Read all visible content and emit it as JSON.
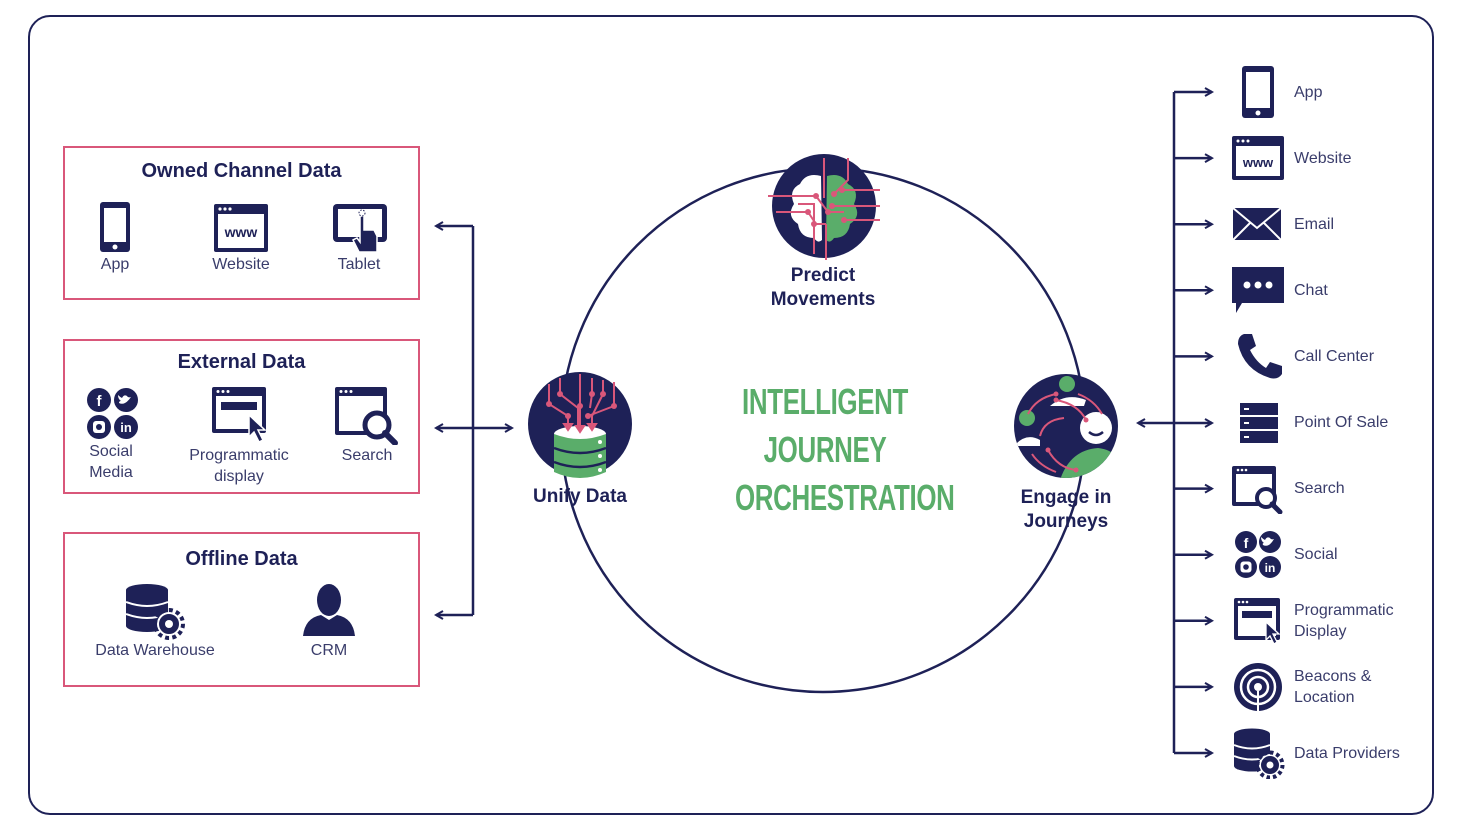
{
  "colors": {
    "navy": "#1e2157",
    "pink": "#d9577a",
    "green": "#5aad6a",
    "text": "#3a3d6b"
  },
  "center_title": [
    "INTELLIGENT",
    "JOURNEY",
    "ORCHESTRATION"
  ],
  "sources": [
    {
      "title": "Owned Channel Data",
      "items": [
        {
          "icon": "mobile-phone-icon",
          "label": "App"
        },
        {
          "icon": "website-www-icon",
          "label": "Website"
        },
        {
          "icon": "tablet-touch-icon",
          "label": "Tablet"
        }
      ]
    },
    {
      "title": "External Data",
      "items": [
        {
          "icon": "social-media-icon",
          "label": "Social Media",
          "lines": [
            "Social",
            "Media"
          ]
        },
        {
          "icon": "programmatic-display-icon",
          "label": "Programmatic display",
          "lines": [
            "Programmatic",
            "display"
          ]
        },
        {
          "icon": "search-window-icon",
          "label": "Search"
        }
      ]
    },
    {
      "title": "Offline Data",
      "items": [
        {
          "icon": "database-gear-icon",
          "label": "Data Warehouse"
        },
        {
          "icon": "person-icon",
          "label": "CRM"
        }
      ]
    }
  ],
  "cycle_nodes": [
    {
      "icon": "brain-circuit-icon",
      "label": "Predict Movements",
      "lines": [
        "Predict",
        "Movements"
      ]
    },
    {
      "icon": "database-merge-icon",
      "label": "Unify Data",
      "lines": [
        "Unify Data"
      ]
    },
    {
      "icon": "people-journey-icon",
      "label": "Engage in Journeys",
      "lines": [
        "Engage in",
        "Journeys"
      ]
    }
  ],
  "channels": [
    {
      "icon": "mobile-phone-icon",
      "label": "App"
    },
    {
      "icon": "website-www-icon",
      "label": "Website"
    },
    {
      "icon": "email-envelope-icon",
      "label": "Email"
    },
    {
      "icon": "chat-bubble-icon",
      "label": "Chat"
    },
    {
      "icon": "phone-handset-icon",
      "label": "Call Center"
    },
    {
      "icon": "server-stack-icon",
      "label": "Point Of Sale"
    },
    {
      "icon": "search-window-icon",
      "label": "Search"
    },
    {
      "icon": "social-media-icon",
      "label": "Social"
    },
    {
      "icon": "programmatic-display-icon",
      "label": "Programmatic Display",
      "lines": [
        "Programmatic",
        "Display"
      ]
    },
    {
      "icon": "beacon-location-icon",
      "label": "Beacons & Location",
      "lines": [
        "Beacons &",
        "Location"
      ]
    },
    {
      "icon": "database-gear-icon",
      "label": "Data Providers"
    }
  ]
}
